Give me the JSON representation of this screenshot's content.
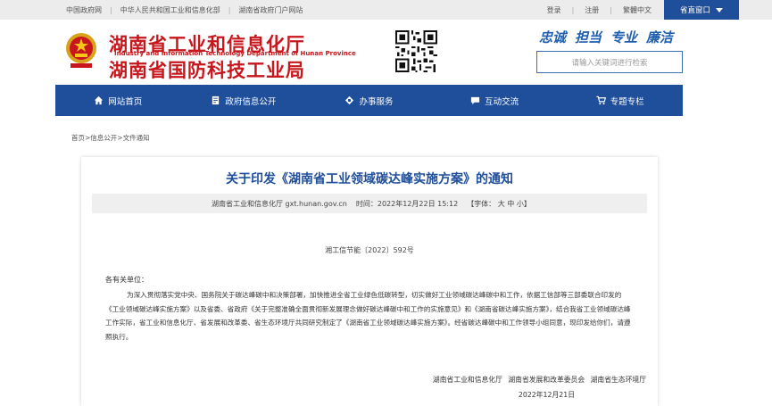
{
  "topbar": {
    "links": [
      "中国政府网",
      "中华人民共和国工业和信息化部",
      "湖南省政府门户网站"
    ],
    "login": "登录",
    "register": "注册",
    "traditional": "繁體中文",
    "portal": "省直窗口",
    "color": "#1f4e9a"
  },
  "header": {
    "title_cn_1": "湖南省工业和信息化厅",
    "title_en_1": "Industry and Information Technology Department of Hunan Province",
    "title_cn_2": "湖南省国防科技工业局",
    "slogan": [
      "忠诚",
      "担当",
      "专业",
      "廉洁"
    ],
    "search_placeholder": "请输入关键词进行检索",
    "title_color": "#c8161d"
  },
  "nav": {
    "items": [
      {
        "label": "网站首页",
        "icon": "home-icon"
      },
      {
        "label": "政府信息公开",
        "icon": "document-icon"
      },
      {
        "label": "办事服务",
        "icon": "service-icon"
      },
      {
        "label": "互动交流",
        "icon": "chat-icon"
      },
      {
        "label": "专题专栏",
        "icon": "cart-icon"
      }
    ]
  },
  "breadcrumb": "首页>信息公开>文件通知",
  "article": {
    "title": "关于印发《湖南省工业领域碳达峰实施方案》的通知",
    "source": "湖南省工业和信息化厅 gxt.hunan.gov.cn",
    "time": "时间：2022年12月22日 15:12",
    "font_size": "【字体： 大 中 小】",
    "doc_number": "湘工信节能〔2022〕592号",
    "salutation": "各有关单位：",
    "body": "为深入贯彻落实党中央、国务院关于碳达峰碳中和决策部署，加快推进全省工业绿色低碳转型，切实做好工业领域碳达峰碳中和工作，依据工信部等三部委联合印发的《工业领域碳达峰实施方案》以及省委、省政府《关于完整准确全面贯彻新发展理念做好碳达峰碳中和工作的实施意见》和《湖南省碳达峰实施方案》，结合我省工业领域碳达峰工作实际，省工业和信息化厅、省发展和改革委、省生态环境厅共同研究制定了《湖南省工业领域碳达峰实施方案》。经省碳达峰碳中和工作领导小组同意，现印发给你们，请遵照执行。",
    "signers": "湖南省工业和信息化厅  湖南省发展和改革委员会  湖南省生态环境厅",
    "date": "2022年12月21日"
  }
}
